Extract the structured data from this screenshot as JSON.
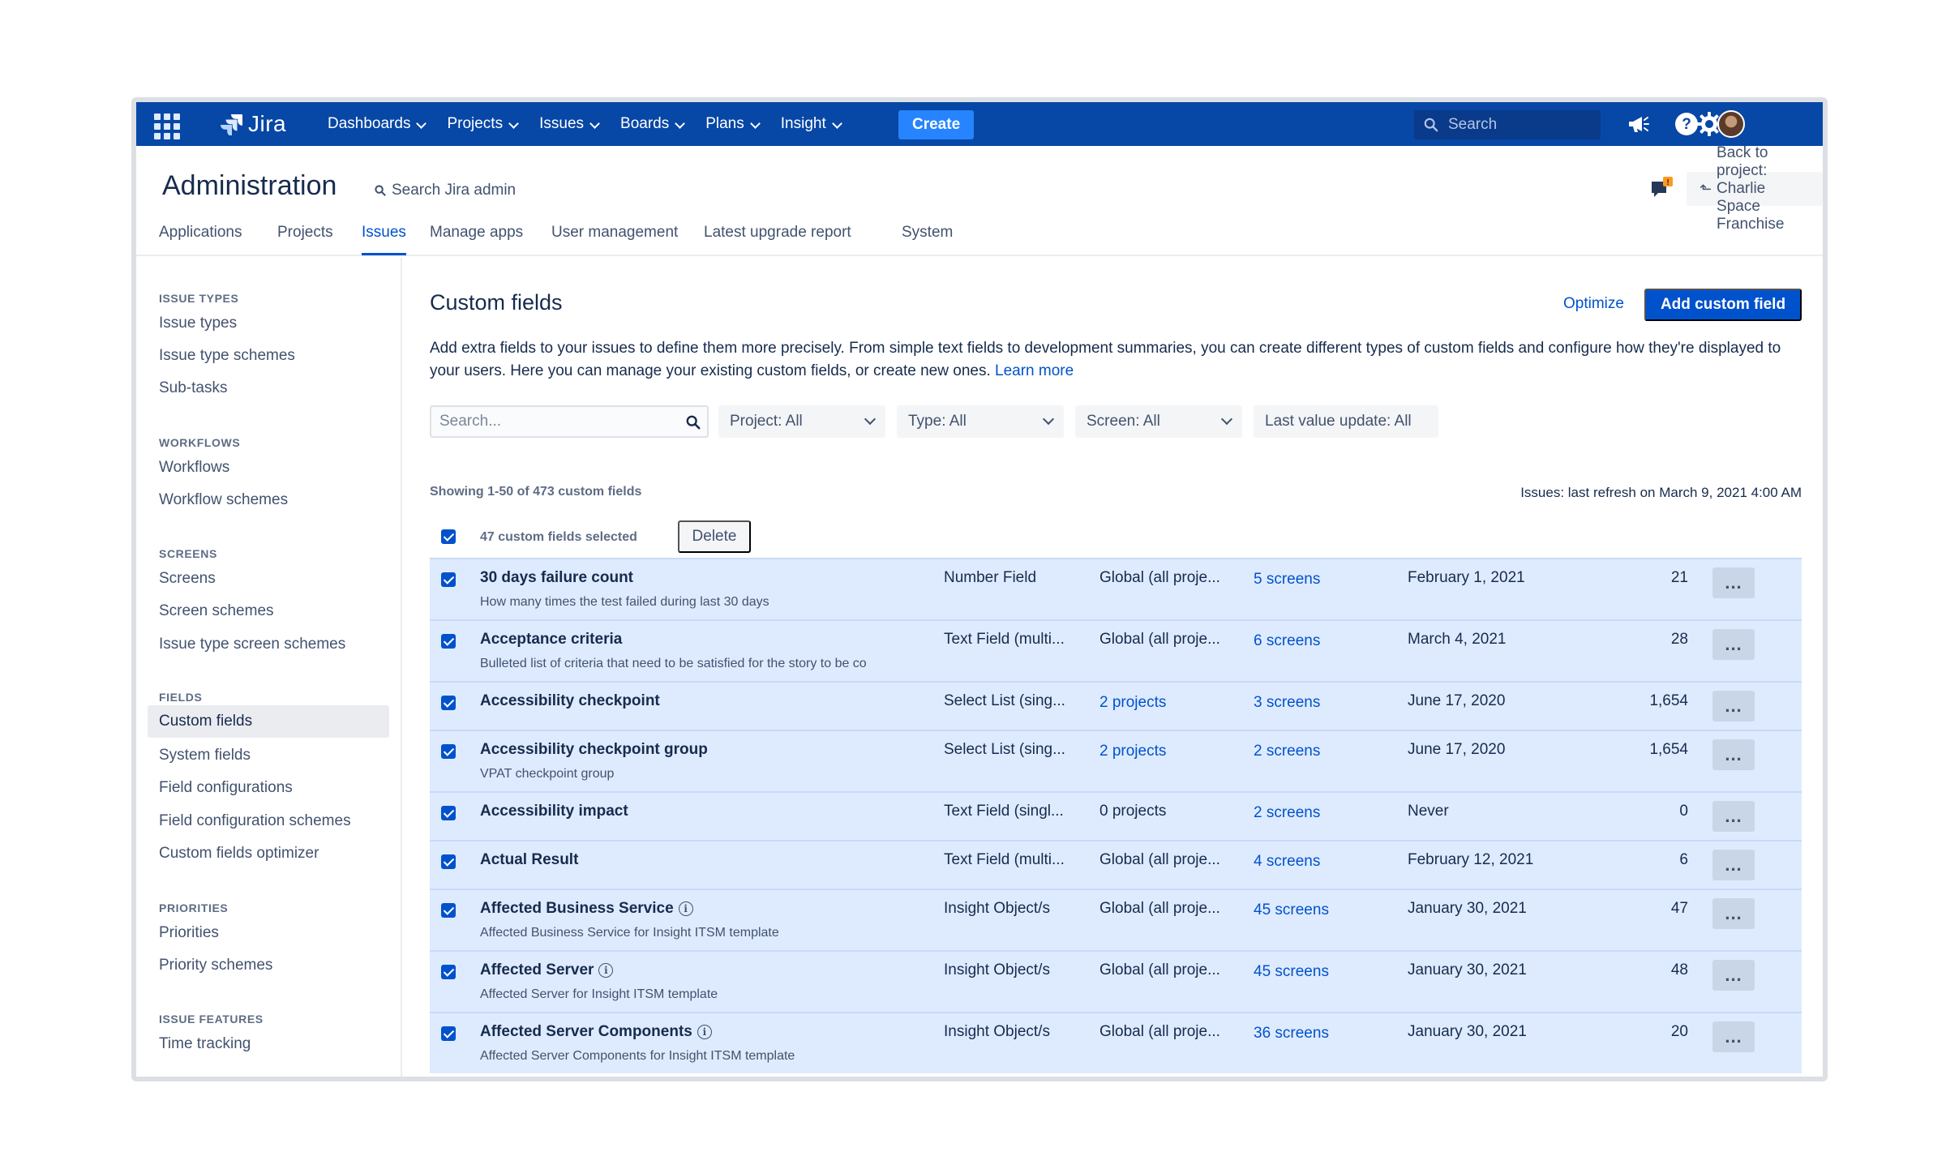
{
  "topnav": {
    "logo": "Jira",
    "items": [
      {
        "label": "Dashboards"
      },
      {
        "label": "Projects"
      },
      {
        "label": "Issues"
      },
      {
        "label": "Boards"
      },
      {
        "label": "Plans"
      },
      {
        "label": "Insight"
      }
    ],
    "create": "Create",
    "search_placeholder": "Search",
    "icons": [
      "notifications-megaphone-icon",
      "help-icon",
      "settings-gear-icon",
      "avatar"
    ]
  },
  "header": {
    "title": "Administration",
    "search_admin": "Search Jira admin",
    "back_button": "Back to project: Charlie Space Franchise"
  },
  "tabs": [
    {
      "label": "Applications"
    },
    {
      "label": "Projects"
    },
    {
      "label": "Issues",
      "active": true
    },
    {
      "label": "Manage apps"
    },
    {
      "label": "User management"
    },
    {
      "label": "Latest upgrade report"
    },
    {
      "label": "System"
    }
  ],
  "sidebar": {
    "sections": [
      {
        "heading": "ISSUE TYPES",
        "items": [
          "Issue types",
          "Issue type schemes",
          "Sub-tasks"
        ]
      },
      {
        "heading": "WORKFLOWS",
        "items": [
          "Workflows",
          "Workflow schemes"
        ]
      },
      {
        "heading": "SCREENS",
        "items": [
          "Screens",
          "Screen schemes",
          "Issue type screen schemes"
        ]
      },
      {
        "heading": "FIELDS",
        "items": [
          "Custom fields",
          "System fields",
          "Field configurations",
          "Field configuration schemes",
          "Custom fields optimizer"
        ]
      },
      {
        "heading": "PRIORITIES",
        "items": [
          "Priorities",
          "Priority schemes"
        ]
      },
      {
        "heading": "ISSUE FEATURES",
        "items": [
          "Time tracking"
        ]
      }
    ],
    "active": "Custom fields"
  },
  "main": {
    "title": "Custom fields",
    "optimize": "Optimize",
    "add_button": "Add custom field",
    "description": "Add extra fields to your issues to define them more precisely. From simple text fields to development summaries, you can create different types of custom fields and configure how they're displayed to your users. Here you can manage your existing custom fields, or create new ones.",
    "learn_more": "Learn more",
    "filters": {
      "search_placeholder": "Search...",
      "project": "Project: All",
      "type": "Type: All",
      "screen": "Screen: All",
      "last_value": "Last value update: All"
    },
    "showing": "Showing 1-50 of 473 custom fields",
    "refresh": "Issues: last refresh on March 9, 2021 4:00 AM",
    "selected_count": "47 custom fields selected",
    "delete": "Delete",
    "more_label": "...",
    "rows": [
      {
        "name": "30 days failure count",
        "info": false,
        "desc": "How many times the test failed during last 30 days",
        "type": "Number Field",
        "context": "Global (all proje...",
        "context_link": false,
        "screens": "5 screens",
        "date": "February 1, 2021",
        "issues": "21"
      },
      {
        "name": "Acceptance criteria",
        "info": false,
        "desc": "Bulleted list of criteria that need to be satisfied for the story to be co",
        "type": "Text Field (multi...",
        "context": "Global (all proje...",
        "context_link": false,
        "screens": "6 screens",
        "date": "March 4, 2021",
        "issues": "28"
      },
      {
        "name": "Accessibility checkpoint",
        "info": false,
        "desc": "",
        "type": "Select List (sing...",
        "context": "2 projects",
        "context_link": true,
        "screens": "3 screens",
        "date": "June 17, 2020",
        "issues": "1,654"
      },
      {
        "name": "Accessibility checkpoint group",
        "info": false,
        "desc": "VPAT checkpoint group",
        "type": "Select List (sing...",
        "context": "2 projects",
        "context_link": true,
        "screens": "2 screens",
        "date": "June 17, 2020",
        "issues": "1,654"
      },
      {
        "name": "Accessibility impact",
        "info": false,
        "desc": "",
        "type": "Text Field (singl...",
        "context": "0 projects",
        "context_link": false,
        "screens": "2 screens",
        "date": "Never",
        "issues": "0"
      },
      {
        "name": "Actual Result",
        "info": false,
        "desc": "",
        "type": "Text Field (multi...",
        "context": "Global (all proje...",
        "context_link": false,
        "screens": "4 screens",
        "date": "February 12, 2021",
        "issues": "6"
      },
      {
        "name": "Affected Business Service",
        "info": true,
        "desc": "Affected Business Service for Insight ITSM template",
        "type": "Insight Object/s",
        "context": "Global (all proje...",
        "context_link": false,
        "screens": "45 screens",
        "date": "January 30, 2021",
        "issues": "47"
      },
      {
        "name": "Affected Server",
        "info": true,
        "desc": "Affected Server for Insight ITSM template",
        "type": "Insight Object/s",
        "context": "Global (all proje...",
        "context_link": false,
        "screens": "45 screens",
        "date": "January 30, 2021",
        "issues": "48"
      },
      {
        "name": "Affected Server Components",
        "info": true,
        "desc": "Affected Server Components for Insight ITSM template",
        "type": "Insight Object/s",
        "context": "Global (all proje...",
        "context_link": false,
        "screens": "36 screens",
        "date": "January 30, 2021",
        "issues": "20"
      }
    ]
  }
}
